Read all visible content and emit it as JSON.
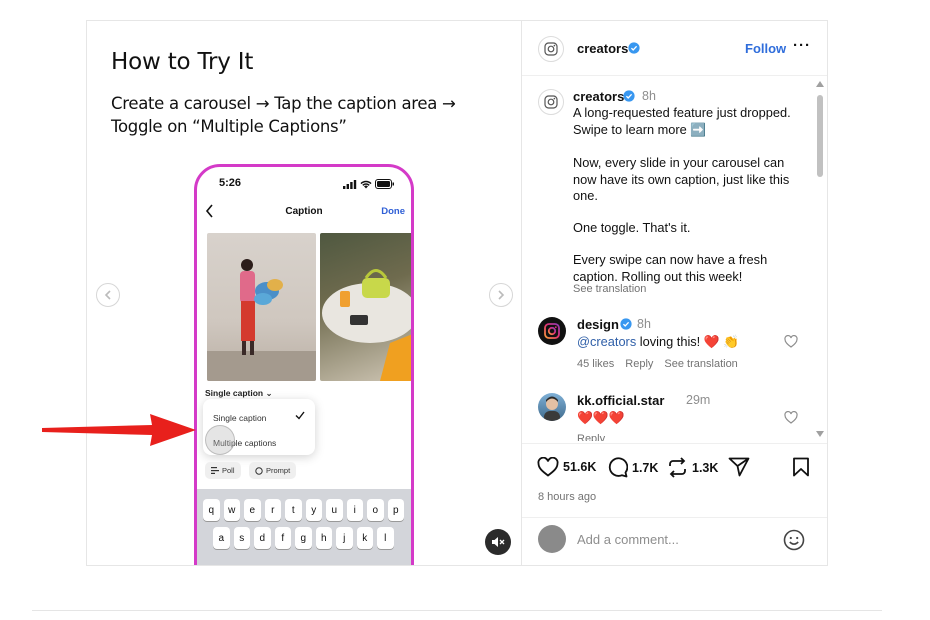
{
  "slide": {
    "title": "How to Try It",
    "instruction": "Create a carousel → Tap the caption area → Toggle on “Multiple Captions”",
    "phone": {
      "time": "5:26",
      "header_title": "Caption",
      "done_label": "Done",
      "caption_selector": "Single caption ⌄",
      "option_single": "Single caption",
      "option_multiple": "Multiple captions",
      "chip_poll": "Poll",
      "chip_prompt": "Prompt",
      "keyboard_row1": [
        "q",
        "w",
        "e",
        "r",
        "t",
        "y",
        "u",
        "i",
        "o",
        "p"
      ],
      "keyboard_row2": [
        "a",
        "s",
        "d",
        "f",
        "g",
        "h",
        "j",
        "k",
        "l"
      ]
    }
  },
  "post": {
    "username": "creators",
    "follow_label": "Follow",
    "more_label": "···",
    "caption": {
      "username": "creators",
      "time": "8h",
      "p1": "A long-requested feature just dropped. Swipe to learn more ➡️",
      "p2": "Now, every slide in your carousel can now have its own caption, just like this one.",
      "p3": "One toggle. That's it.",
      "p4": "Every swipe can now have a fresh caption. Rolling out this week!",
      "see_translation": "See translation"
    },
    "comments": [
      {
        "username": "design",
        "time": "8h",
        "mention": "@creators",
        "text": " loving this! ❤️ 👏",
        "likes": "45 likes",
        "reply": "Reply",
        "see_translation": "See translation"
      },
      {
        "username": "kk.official.star",
        "time": "29m",
        "text": "❤️❤️❤️",
        "reply": "Reply"
      }
    ],
    "likes_count": "51.6K",
    "comments_count": "1.7K",
    "reposts_count": "1.3K",
    "timestamp": "8 hours ago",
    "add_comment_placeholder": "Add a comment..."
  },
  "colors": {
    "accent_blue": "#2f6ddb",
    "phone_border": "#d43ac8",
    "arrow_red": "#e8201c"
  }
}
